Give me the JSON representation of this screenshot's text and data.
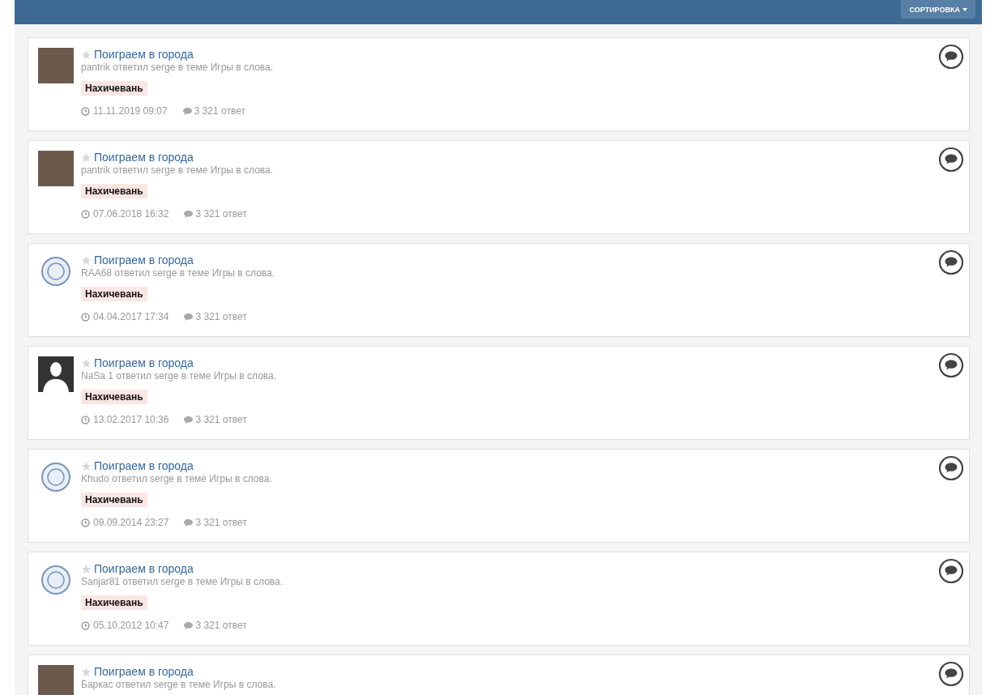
{
  "header": {
    "sort_button": "СОРТИРОВКА"
  },
  "topics": [
    {
      "avatar": {
        "kind": "photo"
      },
      "starred": false,
      "title": "Поиграем в города",
      "byline": "pantrik ответил serge в теме Игры в слова.",
      "tag": "Нахичевань",
      "date": "11.11.2019 09:07",
      "replies": "3 321 ответ"
    },
    {
      "avatar": {
        "kind": "photo"
      },
      "starred": false,
      "title": "Поиграем в города",
      "byline": "pantrik ответил serge в теме Игры в слова.",
      "tag": "Нахичевань",
      "date": "07.06.2018 16:32",
      "replies": "3 321 ответ"
    },
    {
      "avatar": {
        "kind": "emblem"
      },
      "starred": false,
      "title": "Поиграем в города",
      "byline": "RAA68 ответил serge в теме Игры в слова.",
      "tag": "Нахичевань",
      "date": "04.04.2017 17:34",
      "replies": "3 321 ответ"
    },
    {
      "avatar": {
        "kind": "silhouette"
      },
      "starred": false,
      "title": "Поиграем в города",
      "byline": "NaSa 1 ответил serge в теме Игры в слова.",
      "tag": "Нахичевань",
      "date": "13.02.2017 10:36",
      "replies": "3 321 ответ"
    },
    {
      "avatar": {
        "kind": "emblem"
      },
      "starred": false,
      "title": "Поиграем в города",
      "byline": "Khudo ответил serge в теме Игры в слова.",
      "tag": "Нахичевань",
      "date": "09.09.2014 23:27",
      "replies": "3 321 ответ"
    },
    {
      "avatar": {
        "kind": "emblem"
      },
      "starred": false,
      "title": "Поиграем в города",
      "byline": "Sanjar81 ответил serge в теме Игры в слова.",
      "tag": "Нахичевань",
      "date": "05.10.2012 10:47",
      "replies": "3 321 ответ"
    },
    {
      "avatar": {
        "kind": "photo"
      },
      "starred": false,
      "title": "Поиграем в города",
      "byline": "Баркас ответил serge в теме Игры в слова."
    }
  ]
}
